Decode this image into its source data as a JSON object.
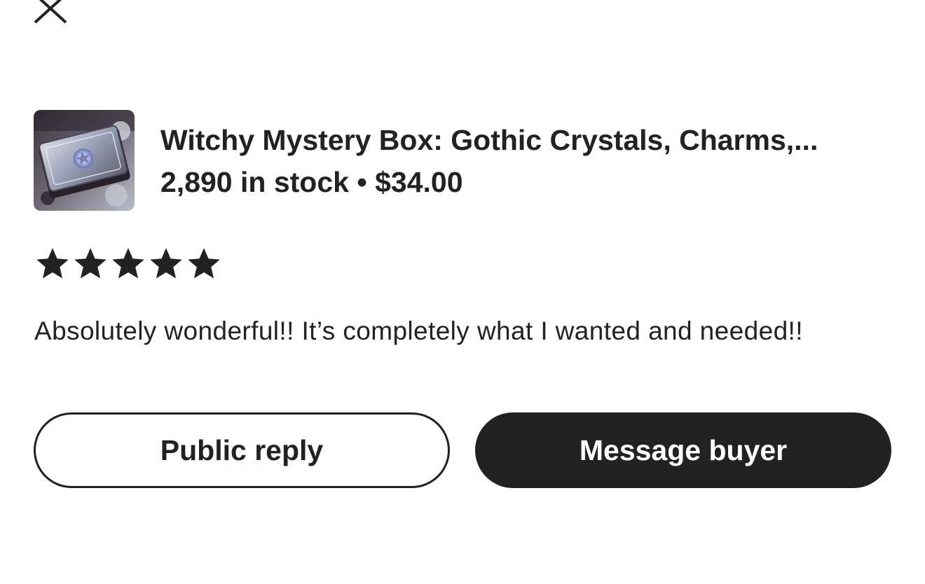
{
  "header": {
    "close_icon": "close-icon"
  },
  "product": {
    "thumbnail_icon": "product-thumbnail",
    "title": "Witchy Mystery Box: Gothic Crystals, Charms,...",
    "stock": "2,890 in stock",
    "separator": "•",
    "price": "$34.00"
  },
  "review": {
    "rating": 5,
    "rating_max": 5,
    "text": "Absolutely wonderful!! It’s completely what I wanted and needed!!"
  },
  "actions": {
    "public_reply_label": "Public reply",
    "message_buyer_label": "Message buyer"
  },
  "colors": {
    "text": "#222222",
    "background": "#ffffff",
    "primary_button": "#222222"
  }
}
